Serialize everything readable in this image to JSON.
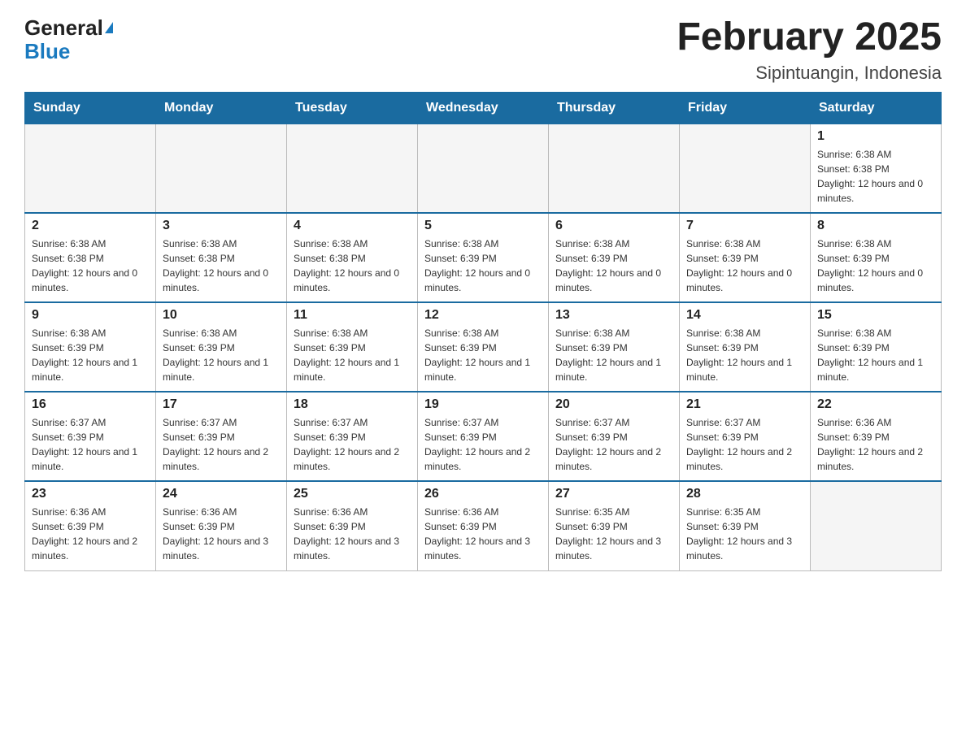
{
  "header": {
    "logo_general": "General",
    "logo_blue": "Blue",
    "month_title": "February 2025",
    "location": "Sipintuangin, Indonesia"
  },
  "weekdays": [
    "Sunday",
    "Monday",
    "Tuesday",
    "Wednesday",
    "Thursday",
    "Friday",
    "Saturday"
  ],
  "rows": [
    [
      {
        "day": "",
        "empty": true
      },
      {
        "day": "",
        "empty": true
      },
      {
        "day": "",
        "empty": true
      },
      {
        "day": "",
        "empty": true
      },
      {
        "day": "",
        "empty": true
      },
      {
        "day": "",
        "empty": true
      },
      {
        "day": "1",
        "sunrise": "6:38 AM",
        "sunset": "6:38 PM",
        "daylight": "12 hours and 0 minutes."
      }
    ],
    [
      {
        "day": "2",
        "sunrise": "6:38 AM",
        "sunset": "6:38 PM",
        "daylight": "12 hours and 0 minutes."
      },
      {
        "day": "3",
        "sunrise": "6:38 AM",
        "sunset": "6:38 PM",
        "daylight": "12 hours and 0 minutes."
      },
      {
        "day": "4",
        "sunrise": "6:38 AM",
        "sunset": "6:38 PM",
        "daylight": "12 hours and 0 minutes."
      },
      {
        "day": "5",
        "sunrise": "6:38 AM",
        "sunset": "6:39 PM",
        "daylight": "12 hours and 0 minutes."
      },
      {
        "day": "6",
        "sunrise": "6:38 AM",
        "sunset": "6:39 PM",
        "daylight": "12 hours and 0 minutes."
      },
      {
        "day": "7",
        "sunrise": "6:38 AM",
        "sunset": "6:39 PM",
        "daylight": "12 hours and 0 minutes."
      },
      {
        "day": "8",
        "sunrise": "6:38 AM",
        "sunset": "6:39 PM",
        "daylight": "12 hours and 0 minutes."
      }
    ],
    [
      {
        "day": "9",
        "sunrise": "6:38 AM",
        "sunset": "6:39 PM",
        "daylight": "12 hours and 1 minute."
      },
      {
        "day": "10",
        "sunrise": "6:38 AM",
        "sunset": "6:39 PM",
        "daylight": "12 hours and 1 minute."
      },
      {
        "day": "11",
        "sunrise": "6:38 AM",
        "sunset": "6:39 PM",
        "daylight": "12 hours and 1 minute."
      },
      {
        "day": "12",
        "sunrise": "6:38 AM",
        "sunset": "6:39 PM",
        "daylight": "12 hours and 1 minute."
      },
      {
        "day": "13",
        "sunrise": "6:38 AM",
        "sunset": "6:39 PM",
        "daylight": "12 hours and 1 minute."
      },
      {
        "day": "14",
        "sunrise": "6:38 AM",
        "sunset": "6:39 PM",
        "daylight": "12 hours and 1 minute."
      },
      {
        "day": "15",
        "sunrise": "6:38 AM",
        "sunset": "6:39 PM",
        "daylight": "12 hours and 1 minute."
      }
    ],
    [
      {
        "day": "16",
        "sunrise": "6:37 AM",
        "sunset": "6:39 PM",
        "daylight": "12 hours and 1 minute."
      },
      {
        "day": "17",
        "sunrise": "6:37 AM",
        "sunset": "6:39 PM",
        "daylight": "12 hours and 2 minutes."
      },
      {
        "day": "18",
        "sunrise": "6:37 AM",
        "sunset": "6:39 PM",
        "daylight": "12 hours and 2 minutes."
      },
      {
        "day": "19",
        "sunrise": "6:37 AM",
        "sunset": "6:39 PM",
        "daylight": "12 hours and 2 minutes."
      },
      {
        "day": "20",
        "sunrise": "6:37 AM",
        "sunset": "6:39 PM",
        "daylight": "12 hours and 2 minutes."
      },
      {
        "day": "21",
        "sunrise": "6:37 AM",
        "sunset": "6:39 PM",
        "daylight": "12 hours and 2 minutes."
      },
      {
        "day": "22",
        "sunrise": "6:36 AM",
        "sunset": "6:39 PM",
        "daylight": "12 hours and 2 minutes."
      }
    ],
    [
      {
        "day": "23",
        "sunrise": "6:36 AM",
        "sunset": "6:39 PM",
        "daylight": "12 hours and 2 minutes."
      },
      {
        "day": "24",
        "sunrise": "6:36 AM",
        "sunset": "6:39 PM",
        "daylight": "12 hours and 3 minutes."
      },
      {
        "day": "25",
        "sunrise": "6:36 AM",
        "sunset": "6:39 PM",
        "daylight": "12 hours and 3 minutes."
      },
      {
        "day": "26",
        "sunrise": "6:36 AM",
        "sunset": "6:39 PM",
        "daylight": "12 hours and 3 minutes."
      },
      {
        "day": "27",
        "sunrise": "6:35 AM",
        "sunset": "6:39 PM",
        "daylight": "12 hours and 3 minutes."
      },
      {
        "day": "28",
        "sunrise": "6:35 AM",
        "sunset": "6:39 PM",
        "daylight": "12 hours and 3 minutes."
      },
      {
        "day": "",
        "empty": true
      }
    ]
  ]
}
